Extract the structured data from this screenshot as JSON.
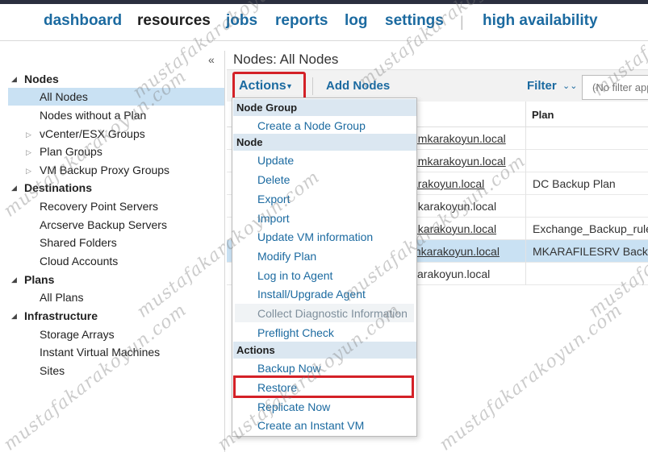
{
  "nav": {
    "items": [
      {
        "label": "dashboard",
        "active": false
      },
      {
        "label": "resources",
        "active": true
      },
      {
        "label": "jobs",
        "active": false
      },
      {
        "label": "reports",
        "active": false
      },
      {
        "label": "log",
        "active": false
      },
      {
        "label": "settings",
        "active": false
      },
      {
        "label": "high availability",
        "active": false
      }
    ],
    "separator": "|"
  },
  "sidebar": {
    "collapse_icon": "«",
    "groups": [
      {
        "label": "Nodes",
        "items": [
          {
            "label": "All Nodes",
            "selected": true,
            "expandable": false
          },
          {
            "label": "Nodes without a Plan",
            "selected": false,
            "expandable": false
          },
          {
            "label": "vCenter/ESX Groups",
            "selected": false,
            "expandable": true
          },
          {
            "label": "Plan Groups",
            "selected": false,
            "expandable": true
          },
          {
            "label": "VM Backup Proxy Groups",
            "selected": false,
            "expandable": true
          }
        ]
      },
      {
        "label": "Destinations",
        "items": [
          {
            "label": "Recovery Point Servers"
          },
          {
            "label": "Arcserve Backup Servers"
          },
          {
            "label": "Shared Folders"
          },
          {
            "label": "Cloud Accounts"
          }
        ]
      },
      {
        "label": "Plans",
        "items": [
          {
            "label": "All Plans"
          }
        ]
      },
      {
        "label": "Infrastructure",
        "items": [
          {
            "label": "Storage Arrays"
          },
          {
            "label": "Instant Virtual Machines"
          },
          {
            "label": "Sites"
          }
        ]
      }
    ]
  },
  "content": {
    "title": "Nodes: All Nodes",
    "toolbar": {
      "actions_label": "Actions",
      "add_nodes_label": "Add Nodes",
      "filter_label": "Filter",
      "filter_placeholder": "(No filter app"
    },
    "grid": {
      "plan_header": "Plan",
      "rows": [
        {
          "name": "r.mkarakoyun.local",
          "plan": "",
          "underline": true,
          "selected": false
        },
        {
          "name": "r.mkarakoyun.local",
          "plan": "",
          "underline": true,
          "selected": false
        },
        {
          "name": "arakoyun.local",
          "plan": "DC Backup Plan",
          "underline": true,
          "selected": false
        },
        {
          "name": "nkarakoyun.local",
          "plan": "",
          "underline": false,
          "selected": false
        },
        {
          "name": "nkarakoyun.local",
          "plan": "Exchange_Backup_rule",
          "underline": true,
          "selected": false
        },
        {
          "name": "mkarakoyun.local",
          "plan": "MKARAFILESRV Backup",
          "underline": true,
          "selected": true
        },
        {
          "name": "karakoyun.local",
          "plan": "",
          "underline": false,
          "selected": false
        }
      ]
    }
  },
  "menu": {
    "sections": [
      {
        "label": "Node Group",
        "items": [
          {
            "label": "Create a Node Group"
          }
        ]
      },
      {
        "label": "Node",
        "items": [
          {
            "label": "Update"
          },
          {
            "label": "Delete"
          },
          {
            "label": "Export"
          },
          {
            "label": "Import"
          },
          {
            "label": "Update VM information"
          },
          {
            "label": "Modify Plan"
          },
          {
            "label": "Log in to Agent"
          },
          {
            "label": "Install/Upgrade Agent"
          },
          {
            "label": "Collect Diagnostic Information",
            "disabled": true
          },
          {
            "label": "Preflight Check"
          }
        ]
      },
      {
        "label": "Actions",
        "items": [
          {
            "label": "Backup Now"
          },
          {
            "label": "Restore",
            "highlighted_box": true
          },
          {
            "label": "Replicate Now"
          },
          {
            "label": "Create an Instant VM"
          }
        ]
      }
    ]
  },
  "watermark": "mustafakarakoyun.com",
  "colors": {
    "nav_link": "#1b6aa0",
    "nav_active": "#1f1f1f",
    "selection": "#c9e1f3",
    "menu_section_bg": "#dbe7f1",
    "highlight_border": "#d42127"
  }
}
